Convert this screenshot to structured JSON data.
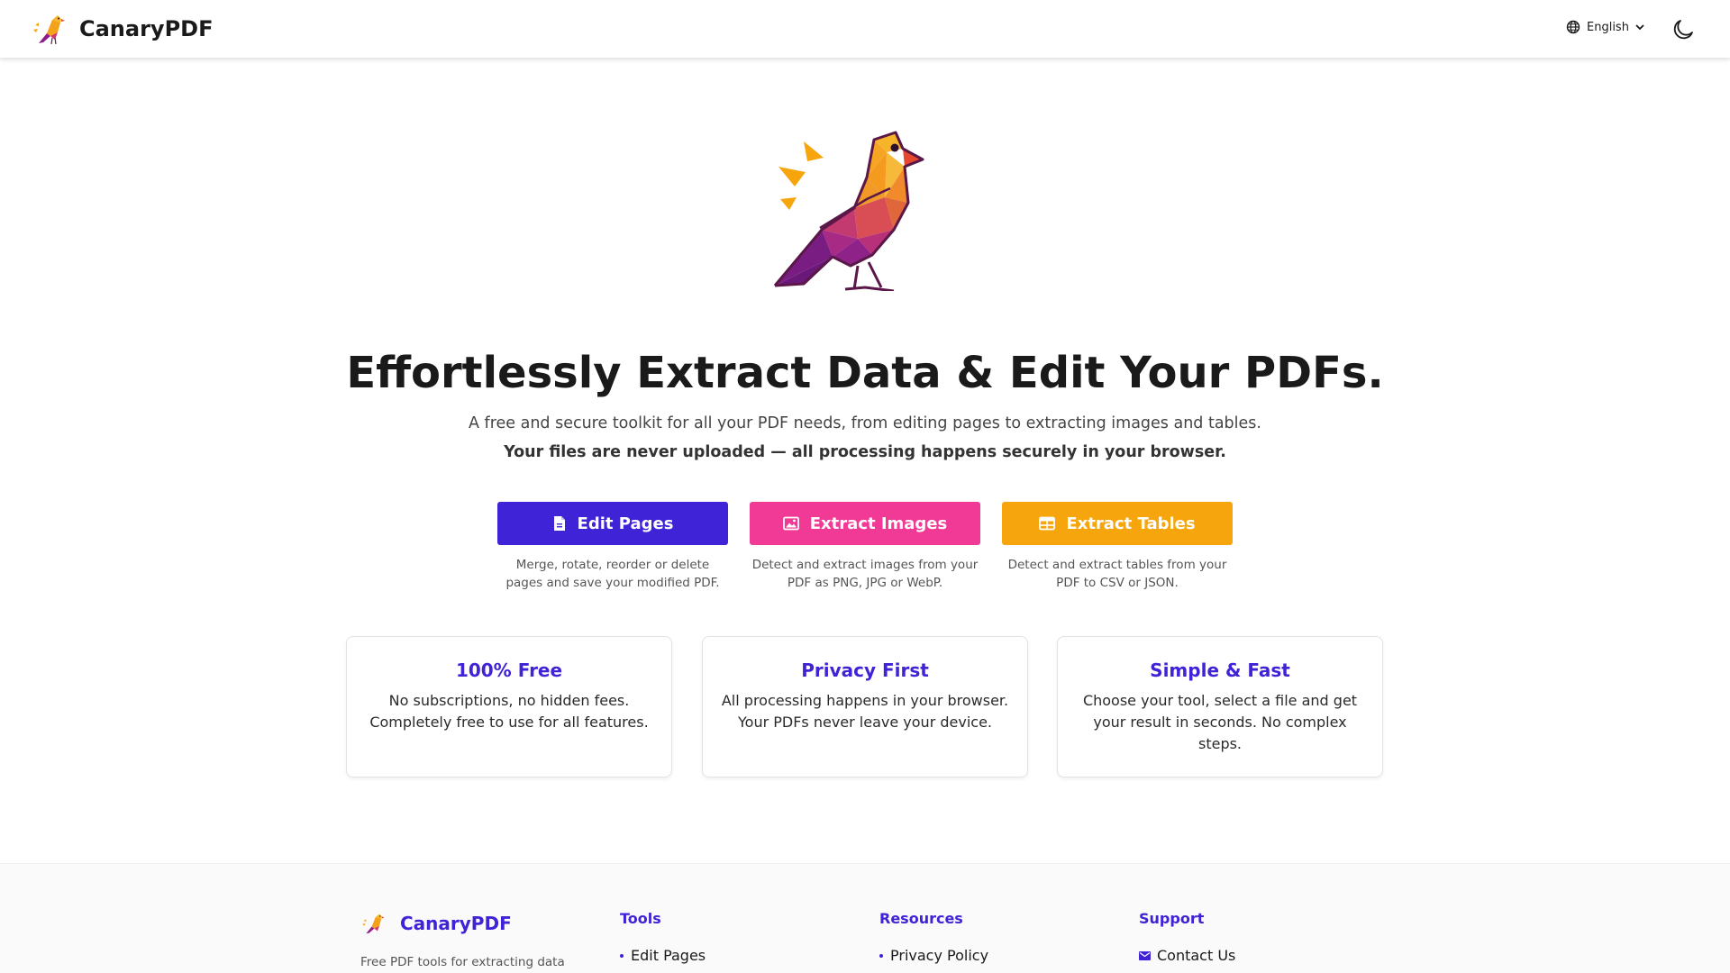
{
  "header": {
    "brand_name": "CanaryPDF",
    "logo_icon": "canary-bird-logo-icon",
    "language_label": "English",
    "language_icon": "globe-icon",
    "theme_icon": "moon-icon"
  },
  "hero": {
    "logo_icon": "canary-bird-illustration",
    "headline": "Effortlessly Extract Data & Edit Your PDFs.",
    "subline": "A free and secure toolkit for all your PDF needs, from editing pages to extracting images and tables.",
    "subline_strong": "Your files are never uploaded — all processing happens securely in your browser."
  },
  "tools": [
    {
      "label": "Edit Pages",
      "icon": "document-icon",
      "color": "#3f23d6",
      "description": "Merge, rotate, reorder or delete pages and save your modified PDF."
    },
    {
      "label": "Extract Images",
      "icon": "image-icon",
      "color": "#f03a96",
      "description": "Detect and extract images from your PDF as PNG, JPG or WebP."
    },
    {
      "label": "Extract Tables",
      "icon": "table-icon",
      "color": "#f7a50c",
      "description": "Detect and extract tables from your PDF to CSV or JSON."
    }
  ],
  "features": [
    {
      "title": "100% Free",
      "text": "No subscriptions, no hidden fees. Completely free to use for all features."
    },
    {
      "title": "Privacy First",
      "text": "All processing happens in your browser. Your PDFs never leave your device."
    },
    {
      "title": "Simple & Fast",
      "text": "Choose your tool, select a file and get your result in seconds. No complex steps."
    }
  ],
  "footer": {
    "brand_name": "CanaryPDF",
    "tagline": "Free PDF tools for extracting data",
    "columns": [
      {
        "title": "Tools",
        "links": [
          "Edit Pages"
        ]
      },
      {
        "title": "Resources",
        "links": [
          "Privacy Policy"
        ]
      },
      {
        "title": "Support",
        "links": [
          "Contact Us"
        ],
        "icon": "mail-icon"
      }
    ]
  },
  "colors": {
    "accent": "#3f23d6",
    "pink": "#f03a96",
    "orange": "#f7a50c"
  }
}
